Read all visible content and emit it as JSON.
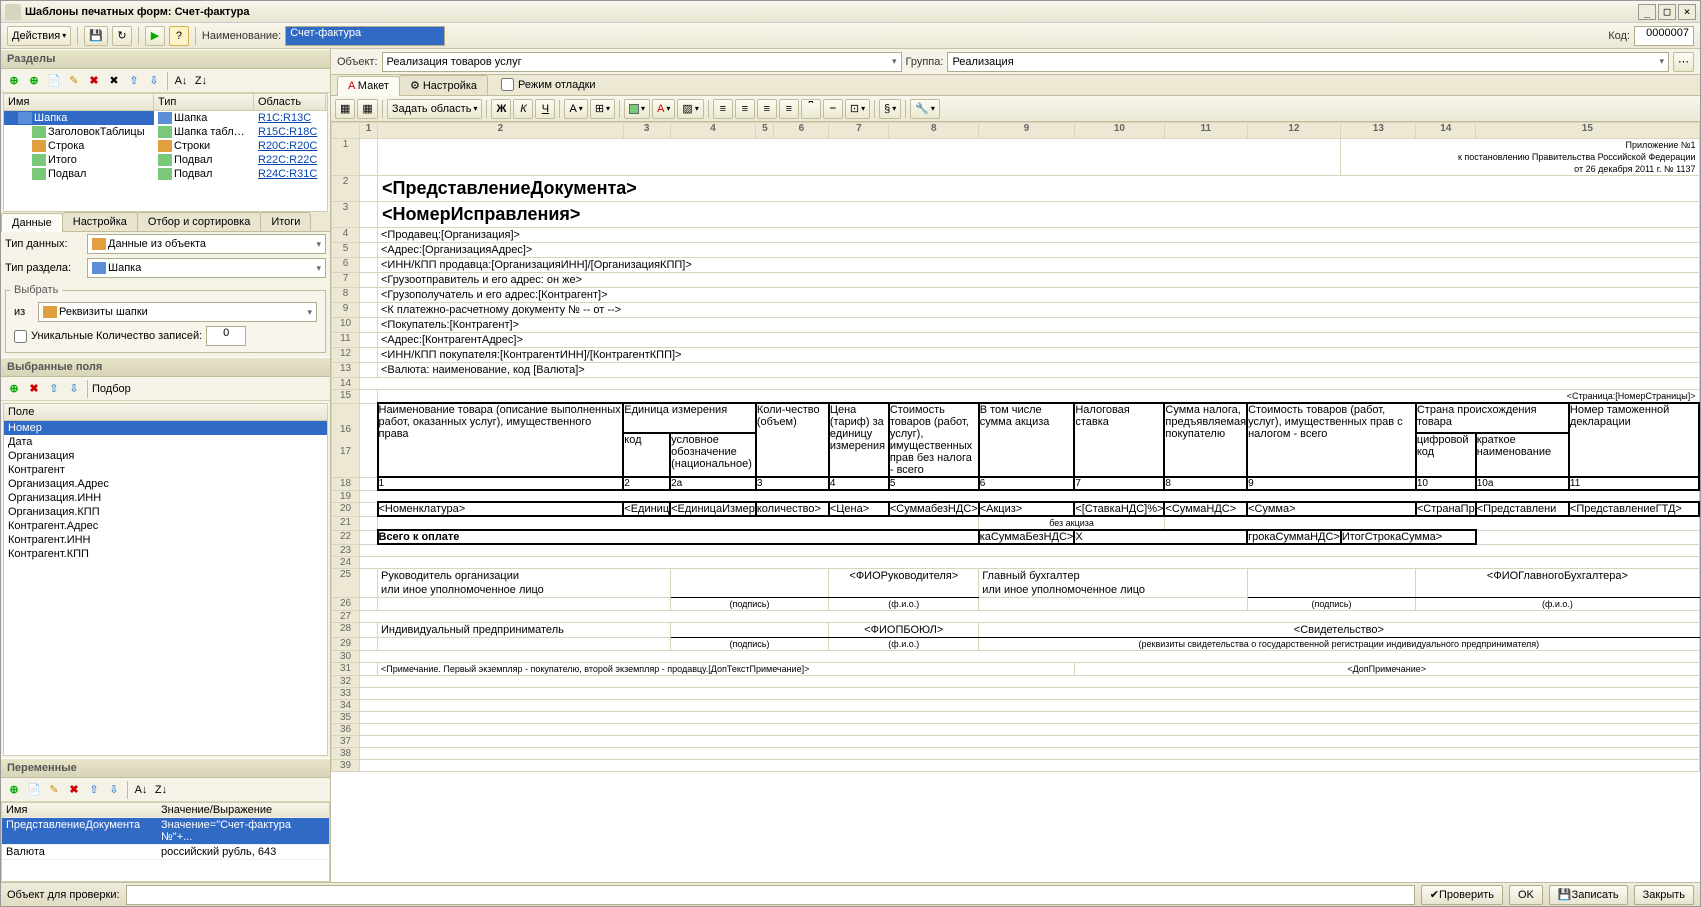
{
  "window": {
    "title": "Шаблоны печатных форм: Счет-фактура"
  },
  "toolbar": {
    "actions": "Действия",
    "name_label": "Наименование:",
    "name_value": "Счет-фактура",
    "code_label": "Код:",
    "code_value": "0000007"
  },
  "left": {
    "sections_title": "Разделы",
    "cols": {
      "name": "Имя",
      "type": "Тип",
      "area": "Область"
    },
    "rows": [
      {
        "name": "Шапка",
        "type": "Шапка",
        "area": "R1С:R13С",
        "icon": "ni-blue",
        "sel": true,
        "indent": 1
      },
      {
        "name": "ЗаголовокТаблицы",
        "type": "Шапка таблицы",
        "area": "R15С:R18С",
        "icon": "ni-tbl",
        "indent": 2
      },
      {
        "name": "Строка",
        "type": "Строки",
        "area": "R20С:R20С",
        "icon": "ni-row",
        "indent": 2
      },
      {
        "name": "Итого",
        "type": "Подвал",
        "area": "R22С:R22С",
        "icon": "ni-tbl",
        "indent": 2
      },
      {
        "name": "Подвал",
        "type": "Подвал",
        "area": "R24С:R31С",
        "icon": "ni-tbl",
        "indent": 2
      }
    ],
    "tabs": {
      "data": "Данные",
      "settings": "Настройка",
      "filter": "Отбор и сортировка",
      "totals": "Итоги"
    },
    "data_type_label": "Тип данных:",
    "data_type_value": "Данные из объекта",
    "section_type_label": "Тип раздела:",
    "section_type_value": "Шапка",
    "select_legend": "Выбрать",
    "from_label": "из",
    "from_value": "Реквизиты шапки",
    "unique_label": "Уникальные",
    "count_label": "Количество записей:",
    "count_value": "0",
    "selected_fields_title": "Выбранные поля",
    "pick_label": "Подбор",
    "field_col": "Поле",
    "fields": [
      "Номер",
      "Дата",
      "Организация",
      "Контрагент",
      "Организация.Адрес",
      "Организация.ИНН",
      "Организация.КПП",
      "Контрагент.Адрес",
      "Контрагент.ИНН",
      "Контрагент.КПП"
    ],
    "vars_title": "Переменные",
    "var_cols": {
      "name": "Имя",
      "val": "Значение/Выражение"
    },
    "vars": [
      {
        "name": "ПредставлениеДокумента",
        "val": "Значение=\"Счет-фактура №\"+...",
        "sel": true
      },
      {
        "name": "Валюта",
        "val": "российский рубль, 643"
      }
    ]
  },
  "right": {
    "object_label": "Объект:",
    "object_value": "Реализация товаров услуг",
    "group_label": "Группа:",
    "group_value": "Реализация",
    "tab_layout": "Макет",
    "tab_settings": "Настройка",
    "debug_label": "Режим отладки",
    "set_area": "Задать область",
    "doc": {
      "title1": "<ПредставлениеДокумента>",
      "title2": "<НомерИсправления>",
      "appendix1": "Приложение №1",
      "appendix2": "к постановлению Правительства Российской Федерации",
      "appendix3": "от 26 декабря 2011 г. № 1137",
      "seller": "<Продавец:[Организация]>",
      "addr": "<Адрес:[ОрганизацияАдрес]>",
      "inn_seller": "<ИНН/КПП продавца:[ОрганизацияИНН]/[ОрганизацияКПП]>",
      "shipper": "<Грузоотправитель и его адрес: он же>",
      "consignee": "<Грузополучатель и его адрес:[Контрагент]>",
      "payment": "<К платежно-расчетному документу № -- от -->",
      "buyer": "<Покупатель:[Контрагент]>",
      "buyer_addr": "<Адрес:[КонтрагентАдрес]>",
      "inn_buyer": "<ИНН/КПП покупателя:[КонтрагентИНН]/[КонтрагентКПП]>",
      "currency": "<Валюта: наименование, код [Валюта]>",
      "page": "<Страница:[НомерСтраницы]>",
      "th": {
        "name": "Наименование товара (описание выполненных работ, оказанных услуг), имущественного права",
        "unit": "Единица измерения",
        "code": "код",
        "unit_name": "условное обозначение (национальное)",
        "qty": "Коли-чество (объем)",
        "price": "Цена (тариф) за единицу измерения",
        "cost_wo": "Стоимость товаров (работ, услуг), имущественных прав без налога - всего",
        "excise": "В том числе сумма акциза",
        "tax_rate": "Налоговая ставка",
        "tax_sum": "Сумма налога, предъявляемая покупателю",
        "cost_w": "Стоимость товаров (работ, услуг), имущественных прав с налогом - всего",
        "country": "Страна происхождения товара",
        "country_code": "цифровой код",
        "country_name": "краткое наименование",
        "gtd": "Номер таможенной декларации"
      },
      "row": {
        "nom": "<Номенклатура>",
        "unit": "<Единиц",
        "unit2": "<ЕдиницаИзмер",
        "qty": "количество>",
        "price": "<Цена>",
        "sum_wo": "<СуммабезНДС>",
        "excise": "<Акциз>",
        "rate": "<[СтавкаНДС]%>",
        "tax": "<СуммаНДС>",
        "sum": "<Сумма>",
        "country_c": "<СтранаПр",
        "country_n": "<Представлени",
        "gtd": "<ПредставлениеГТД>"
      },
      "total_label": "Всего к оплате",
      "no_excise": "без акциза",
      "total_wo": "каСуммаБезНДС>",
      "total_x": "X",
      "total_tax": "грокаСуммаНДС>",
      "total_sum": "ИтогСтрокаСумма>",
      "head": "Руководитель организации",
      "head2": "или иное уполномоченное лицо",
      "head_fio": "<ФИОРуководителя>",
      "acc": "Главный бухгалтер",
      "acc2": "или иное уполномоченное лицо",
      "acc_fio": "<ФИОГлавногоБухгалтера>",
      "sign": "(подпись)",
      "fio": "(ф.и.о.)",
      "ip": "Индивидуальный предприниматель",
      "ip_fio": "<ФИОПБОЮЛ>",
      "cert": "<Свидетельство>",
      "cert_note": "(реквизиты свидетельства о государственной регистрации индивидуального предпринимателя)",
      "note": "<Примечание. Первый экземпляр - покупателю, второй экземпляр - продавцу.[ДопТекстПримечание]>",
      "dop": "<ДопПримечание>"
    }
  },
  "status": {
    "check_label": "Объект для проверки:",
    "check": "Проверить",
    "ok": "OK",
    "save": "Записать",
    "close": "Закрыть"
  }
}
